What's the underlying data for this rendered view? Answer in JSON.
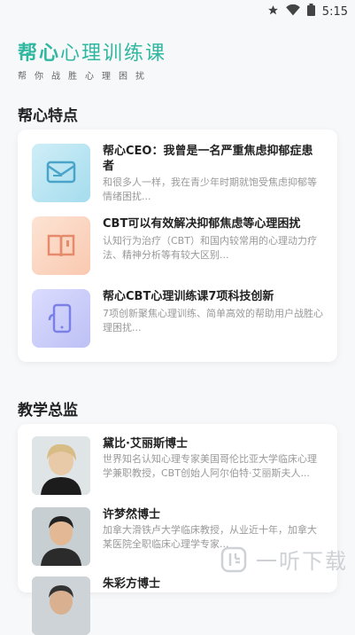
{
  "status_bar": {
    "time": "5:15",
    "icons": [
      "star-icon",
      "wifi-icon",
      "battery-icon"
    ]
  },
  "brand": {
    "title_bold": "帮心",
    "title_rest": "心理训练课",
    "subtitle": "帮你战胜心理困扰"
  },
  "features": {
    "heading": "帮心特点",
    "items": [
      {
        "title": "帮心CEO：我曾是一名严重焦虑抑郁症患者",
        "desc": "和很多人一样，我在青少年时期就饱受焦虑抑郁等情绪困扰...",
        "icon": "mail-icon"
      },
      {
        "title": "CBT可以有效解决抑郁焦虑等心理困扰",
        "desc": "认知行为治疗（CBT）和国内较常用的心理动力疗法、精神分析等有较大区别...",
        "icon": "book-icon"
      },
      {
        "title": "帮心CBT心理训练课7项科技创新",
        "desc": "7项创新聚焦心理训练、简单高效的帮助用户战胜心理困扰...",
        "icon": "phone-icon"
      }
    ]
  },
  "directors": {
    "heading": "教学总监",
    "items": [
      {
        "name": "黛比·艾丽斯博士",
        "desc": "世界知名认知心理专家美国哥伦比亚大学临床心理学兼职教授，CBT创始人阿尔伯特·艾丽斯夫人..."
      },
      {
        "name": "许梦然博士",
        "desc": "加拿大滑铁卢大学临床教授，从业近十年，加拿大某医院全职临床心理学专家..."
      },
      {
        "name": "朱彩方博士",
        "desc": ""
      }
    ]
  },
  "watermark": {
    "text": "一听下载"
  }
}
